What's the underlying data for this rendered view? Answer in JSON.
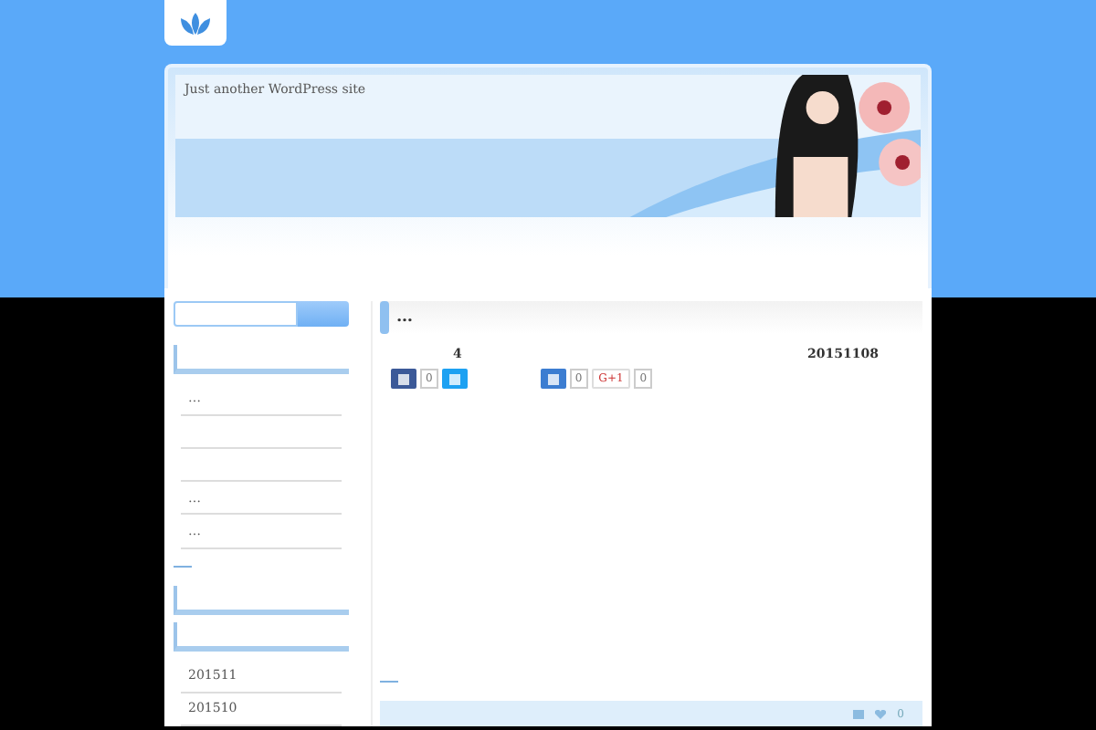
{
  "header": {
    "tagline": "Just another WordPress site"
  },
  "sidebar": {
    "widgets": [
      {
        "kind": "list",
        "items": [
          {
            "kind": "link",
            "text": "…"
          },
          {
            "kind": "blank"
          },
          {
            "kind": "blank"
          },
          {
            "kind": "link",
            "text": "…"
          },
          {
            "kind": "link",
            "text": "…"
          }
        ]
      },
      {
        "kind": "empty"
      },
      {
        "kind": "list",
        "items": [
          {
            "kind": "link",
            "text": "201511"
          },
          {
            "kind": "link",
            "text": "201510"
          }
        ]
      }
    ]
  },
  "post": {
    "title": "…",
    "comments": "4",
    "date": "20151108",
    "shares": [
      {
        "kind": "facebook",
        "count": "0"
      },
      {
        "kind": "twitter"
      },
      {
        "kind": "hatena",
        "count": "0"
      },
      {
        "kind": "gplus",
        "label": "G+1",
        "count": "0"
      }
    ]
  },
  "footer_bar": {
    "likes": "0"
  }
}
